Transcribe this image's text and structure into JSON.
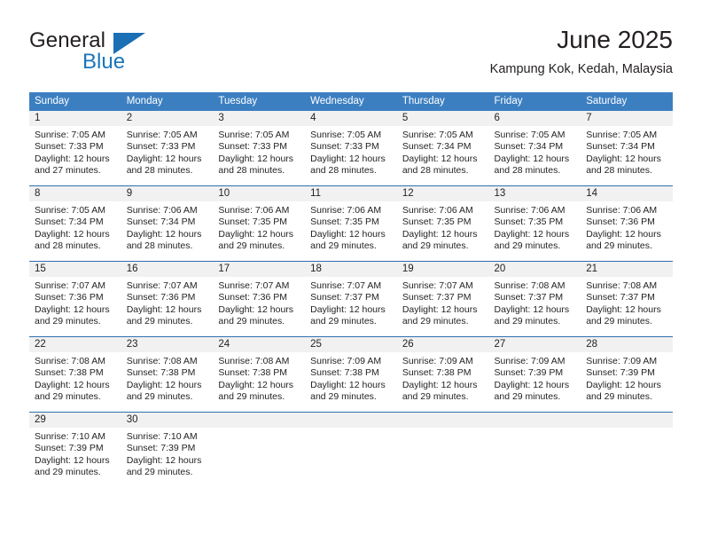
{
  "brand": {
    "name_top": "General",
    "name_bottom": "Blue",
    "accent_color": "#1a75bb"
  },
  "header": {
    "title": "June 2025",
    "subtitle": "Kampung Kok, Kedah, Malaysia"
  },
  "calendar": {
    "header_bg": "#3c7fc1",
    "daynum_bg": "#f1f1f1",
    "separator_color": "#2f6fb0",
    "weekday_headers": [
      "Sunday",
      "Monday",
      "Tuesday",
      "Wednesday",
      "Thursday",
      "Friday",
      "Saturday"
    ],
    "weeks": [
      [
        {
          "day": "1",
          "sunrise": "Sunrise: 7:05 AM",
          "sunset": "Sunset: 7:33 PM",
          "daylight_1": "Daylight: 12 hours",
          "daylight_2": "and 27 minutes."
        },
        {
          "day": "2",
          "sunrise": "Sunrise: 7:05 AM",
          "sunset": "Sunset: 7:33 PM",
          "daylight_1": "Daylight: 12 hours",
          "daylight_2": "and 28 minutes."
        },
        {
          "day": "3",
          "sunrise": "Sunrise: 7:05 AM",
          "sunset": "Sunset: 7:33 PM",
          "daylight_1": "Daylight: 12 hours",
          "daylight_2": "and 28 minutes."
        },
        {
          "day": "4",
          "sunrise": "Sunrise: 7:05 AM",
          "sunset": "Sunset: 7:33 PM",
          "daylight_1": "Daylight: 12 hours",
          "daylight_2": "and 28 minutes."
        },
        {
          "day": "5",
          "sunrise": "Sunrise: 7:05 AM",
          "sunset": "Sunset: 7:34 PM",
          "daylight_1": "Daylight: 12 hours",
          "daylight_2": "and 28 minutes."
        },
        {
          "day": "6",
          "sunrise": "Sunrise: 7:05 AM",
          "sunset": "Sunset: 7:34 PM",
          "daylight_1": "Daylight: 12 hours",
          "daylight_2": "and 28 minutes."
        },
        {
          "day": "7",
          "sunrise": "Sunrise: 7:05 AM",
          "sunset": "Sunset: 7:34 PM",
          "daylight_1": "Daylight: 12 hours",
          "daylight_2": "and 28 minutes."
        }
      ],
      [
        {
          "day": "8",
          "sunrise": "Sunrise: 7:05 AM",
          "sunset": "Sunset: 7:34 PM",
          "daylight_1": "Daylight: 12 hours",
          "daylight_2": "and 28 minutes."
        },
        {
          "day": "9",
          "sunrise": "Sunrise: 7:06 AM",
          "sunset": "Sunset: 7:34 PM",
          "daylight_1": "Daylight: 12 hours",
          "daylight_2": "and 28 minutes."
        },
        {
          "day": "10",
          "sunrise": "Sunrise: 7:06 AM",
          "sunset": "Sunset: 7:35 PM",
          "daylight_1": "Daylight: 12 hours",
          "daylight_2": "and 29 minutes."
        },
        {
          "day": "11",
          "sunrise": "Sunrise: 7:06 AM",
          "sunset": "Sunset: 7:35 PM",
          "daylight_1": "Daylight: 12 hours",
          "daylight_2": "and 29 minutes."
        },
        {
          "day": "12",
          "sunrise": "Sunrise: 7:06 AM",
          "sunset": "Sunset: 7:35 PM",
          "daylight_1": "Daylight: 12 hours",
          "daylight_2": "and 29 minutes."
        },
        {
          "day": "13",
          "sunrise": "Sunrise: 7:06 AM",
          "sunset": "Sunset: 7:35 PM",
          "daylight_1": "Daylight: 12 hours",
          "daylight_2": "and 29 minutes."
        },
        {
          "day": "14",
          "sunrise": "Sunrise: 7:06 AM",
          "sunset": "Sunset: 7:36 PM",
          "daylight_1": "Daylight: 12 hours",
          "daylight_2": "and 29 minutes."
        }
      ],
      [
        {
          "day": "15",
          "sunrise": "Sunrise: 7:07 AM",
          "sunset": "Sunset: 7:36 PM",
          "daylight_1": "Daylight: 12 hours",
          "daylight_2": "and 29 minutes."
        },
        {
          "day": "16",
          "sunrise": "Sunrise: 7:07 AM",
          "sunset": "Sunset: 7:36 PM",
          "daylight_1": "Daylight: 12 hours",
          "daylight_2": "and 29 minutes."
        },
        {
          "day": "17",
          "sunrise": "Sunrise: 7:07 AM",
          "sunset": "Sunset: 7:36 PM",
          "daylight_1": "Daylight: 12 hours",
          "daylight_2": "and 29 minutes."
        },
        {
          "day": "18",
          "sunrise": "Sunrise: 7:07 AM",
          "sunset": "Sunset: 7:37 PM",
          "daylight_1": "Daylight: 12 hours",
          "daylight_2": "and 29 minutes."
        },
        {
          "day": "19",
          "sunrise": "Sunrise: 7:07 AM",
          "sunset": "Sunset: 7:37 PM",
          "daylight_1": "Daylight: 12 hours",
          "daylight_2": "and 29 minutes."
        },
        {
          "day": "20",
          "sunrise": "Sunrise: 7:08 AM",
          "sunset": "Sunset: 7:37 PM",
          "daylight_1": "Daylight: 12 hours",
          "daylight_2": "and 29 minutes."
        },
        {
          "day": "21",
          "sunrise": "Sunrise: 7:08 AM",
          "sunset": "Sunset: 7:37 PM",
          "daylight_1": "Daylight: 12 hours",
          "daylight_2": "and 29 minutes."
        }
      ],
      [
        {
          "day": "22",
          "sunrise": "Sunrise: 7:08 AM",
          "sunset": "Sunset: 7:38 PM",
          "daylight_1": "Daylight: 12 hours",
          "daylight_2": "and 29 minutes."
        },
        {
          "day": "23",
          "sunrise": "Sunrise: 7:08 AM",
          "sunset": "Sunset: 7:38 PM",
          "daylight_1": "Daylight: 12 hours",
          "daylight_2": "and 29 minutes."
        },
        {
          "day": "24",
          "sunrise": "Sunrise: 7:08 AM",
          "sunset": "Sunset: 7:38 PM",
          "daylight_1": "Daylight: 12 hours",
          "daylight_2": "and 29 minutes."
        },
        {
          "day": "25",
          "sunrise": "Sunrise: 7:09 AM",
          "sunset": "Sunset: 7:38 PM",
          "daylight_1": "Daylight: 12 hours",
          "daylight_2": "and 29 minutes."
        },
        {
          "day": "26",
          "sunrise": "Sunrise: 7:09 AM",
          "sunset": "Sunset: 7:38 PM",
          "daylight_1": "Daylight: 12 hours",
          "daylight_2": "and 29 minutes."
        },
        {
          "day": "27",
          "sunrise": "Sunrise: 7:09 AM",
          "sunset": "Sunset: 7:39 PM",
          "daylight_1": "Daylight: 12 hours",
          "daylight_2": "and 29 minutes."
        },
        {
          "day": "28",
          "sunrise": "Sunrise: 7:09 AM",
          "sunset": "Sunset: 7:39 PM",
          "daylight_1": "Daylight: 12 hours",
          "daylight_2": "and 29 minutes."
        }
      ],
      [
        {
          "day": "29",
          "sunrise": "Sunrise: 7:10 AM",
          "sunset": "Sunset: 7:39 PM",
          "daylight_1": "Daylight: 12 hours",
          "daylight_2": "and 29 minutes."
        },
        {
          "day": "30",
          "sunrise": "Sunrise: 7:10 AM",
          "sunset": "Sunset: 7:39 PM",
          "daylight_1": "Daylight: 12 hours",
          "daylight_2": "and 29 minutes."
        },
        {
          "day": "",
          "sunrise": "",
          "sunset": "",
          "daylight_1": "",
          "daylight_2": ""
        },
        {
          "day": "",
          "sunrise": "",
          "sunset": "",
          "daylight_1": "",
          "daylight_2": ""
        },
        {
          "day": "",
          "sunrise": "",
          "sunset": "",
          "daylight_1": "",
          "daylight_2": ""
        },
        {
          "day": "",
          "sunrise": "",
          "sunset": "",
          "daylight_1": "",
          "daylight_2": ""
        },
        {
          "day": "",
          "sunrise": "",
          "sunset": "",
          "daylight_1": "",
          "daylight_2": ""
        }
      ]
    ]
  }
}
